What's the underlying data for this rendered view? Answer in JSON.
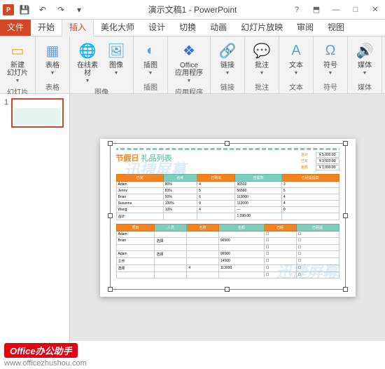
{
  "titlebar": {
    "app_icon_text": "P",
    "title": "演示文稿1 - PowerPoint",
    "qat": {
      "save": "💾",
      "undo": "↶",
      "redo": "↷",
      "start": "▾"
    }
  },
  "tabs": {
    "file": "文件",
    "items": [
      "开始",
      "插入",
      "美化大师",
      "设计",
      "切换",
      "动画",
      "幻灯片放映",
      "审阅",
      "视图"
    ],
    "active_index": 1
  },
  "ribbon": {
    "groups": [
      {
        "label": "幻灯片",
        "buttons": [
          {
            "name": "new-slide",
            "label": "新建\n幻灯片",
            "icon": "▭",
            "color": "#f5a623"
          }
        ]
      },
      {
        "label": "表格",
        "buttons": [
          {
            "name": "table",
            "label": "表格",
            "icon": "▦",
            "color": "#6aa0d8"
          }
        ]
      },
      {
        "label": "图像",
        "buttons": [
          {
            "name": "online",
            "label": "在线素\n材",
            "icon": "🌐",
            "color": "#5aa6d8"
          },
          {
            "name": "image",
            "label": "图像",
            "icon": "🖼",
            "color": "#5aa6d8"
          }
        ]
      },
      {
        "label": "插图",
        "buttons": [
          {
            "name": "illust",
            "label": "插图",
            "icon": "◐",
            "color": "#5aa6d8"
          }
        ]
      },
      {
        "label": "应用程序",
        "buttons": [
          {
            "name": "office-apps",
            "label": "Office\n应用程序",
            "icon": "❖",
            "color": "#2578cf"
          }
        ]
      },
      {
        "label": "链接",
        "buttons": [
          {
            "name": "link",
            "label": "链接",
            "icon": "🔗",
            "color": "#5aa6d8"
          }
        ]
      },
      {
        "label": "批注",
        "buttons": [
          {
            "name": "comment",
            "label": "批注",
            "icon": "💬",
            "color": "#f5a623"
          }
        ]
      },
      {
        "label": "文本",
        "buttons": [
          {
            "name": "text",
            "label": "文本",
            "icon": "A",
            "color": "#5aa6d8"
          }
        ]
      },
      {
        "label": "符号",
        "buttons": [
          {
            "name": "symbol",
            "label": "符号",
            "icon": "Ω",
            "color": "#5aa6d8"
          }
        ]
      },
      {
        "label": "媒体",
        "buttons": [
          {
            "name": "media",
            "label": "媒体",
            "icon": "🔊",
            "color": "#888"
          }
        ]
      }
    ]
  },
  "thumbs": {
    "current": "1"
  },
  "document": {
    "title_part1": "节假日",
    "title_part2": " 礼品列表",
    "summary": [
      {
        "k": "总计",
        "v": "¥  5,000.00"
      },
      {
        "k": "已买",
        "v": "¥  3,910.00"
      },
      {
        "k": "差额",
        "v": "¥  1,090.00"
      }
    ],
    "chart_data": [
      {
        "type": "table",
        "headers": [
          "已完",
          "名称",
          "已购买",
          "应提款",
          "已经提提款"
        ],
        "rows": [
          [
            "Adam",
            "80%",
            "4",
            "96500",
            "3"
          ],
          [
            "Jenny",
            "83%",
            "5",
            "56500",
            "5"
          ],
          [
            "Brian",
            "50%",
            "6",
            "113000",
            "4"
          ],
          [
            "Susanna",
            "100%",
            "9",
            "113000",
            "4"
          ],
          [
            "Wang",
            "13%",
            "4",
            "—",
            "0"
          ],
          [
            "合计",
            "",
            "",
            "1,090.00",
            ""
          ]
        ]
      },
      {
        "type": "table",
        "headers": [
          "项目",
          "人员",
          "名称",
          "名额",
          "已经",
          "已经提"
        ],
        "rows": [
          [
            "Adam",
            "",
            "",
            "",
            "☐",
            "☐"
          ],
          [
            "Brian",
            "选择",
            "",
            "96500",
            "☐",
            "☐"
          ],
          [
            "",
            "",
            "",
            "",
            "☐",
            "☐"
          ],
          [
            "Adam",
            "选择",
            "",
            "96500",
            "☐",
            "☐"
          ],
          [
            "工作",
            "",
            "",
            "14500",
            "☐",
            "☐"
          ],
          [
            "选择",
            "",
            "4",
            "113000",
            "☐",
            "☐"
          ],
          [
            "",
            "",
            "",
            "",
            "☐",
            "☐"
          ]
        ]
      }
    ]
  },
  "footer": {
    "badge": "Office办公助手",
    "url": "www.officezhushou.com"
  },
  "watermark": "迅捷屏幕"
}
